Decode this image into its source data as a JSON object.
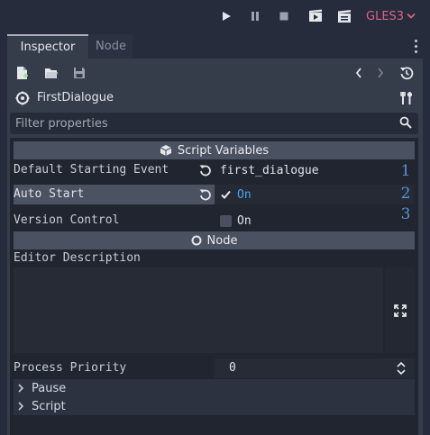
{
  "toolbar": {
    "icons": [
      "play-icon",
      "pause-icon",
      "stop-icon",
      "play-scene-icon",
      "play-custom-scene-icon"
    ],
    "renderer": "GLES3"
  },
  "tabs": [
    {
      "label": "Inspector",
      "active": true
    },
    {
      "label": "Node",
      "active": false
    }
  ],
  "inspector": {
    "object_name": "FirstDialogue",
    "filter_placeholder": "Filter properties"
  },
  "sections": {
    "script_variables": "Script Variables",
    "node": "Node"
  },
  "properties": {
    "default_starting_event": {
      "label": "Default Starting Event",
      "value": "first_dialogue"
    },
    "auto_start": {
      "label": "Auto Start",
      "value": "On",
      "checked": true
    },
    "version_control": {
      "label": "Version Control",
      "value": "On",
      "checked": false
    },
    "editor_description": {
      "label": "Editor Description",
      "value": ""
    },
    "process_priority": {
      "label": "Process Priority",
      "value": "0"
    }
  },
  "groups": {
    "pause": "Pause",
    "script": "Script"
  },
  "annotations": [
    "1",
    "2",
    "3"
  ],
  "colors": {
    "accent": "#4aa3f0",
    "renderer": "#e0608a",
    "annotation": "#5a8fd6"
  }
}
